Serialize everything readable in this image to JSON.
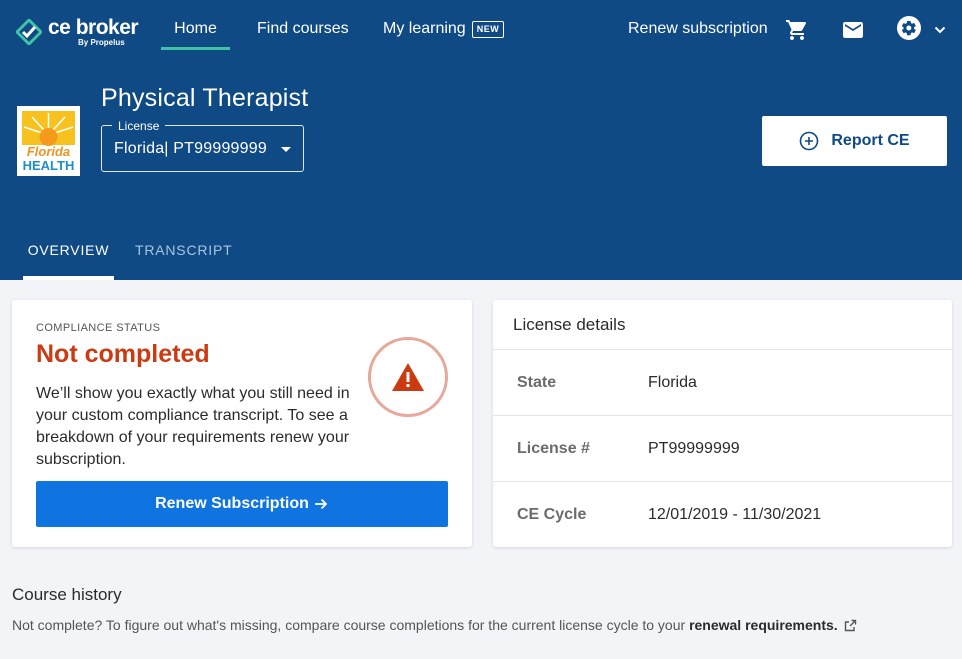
{
  "brand": {
    "name": "ce broker",
    "sub": "By Propelus"
  },
  "nav": {
    "home": "Home",
    "find_courses": "Find courses",
    "my_learning": "My learning",
    "new_badge": "NEW",
    "renew_subscription": "Renew subscription",
    "icons": [
      "cart-icon",
      "mail-icon",
      "gear-icon",
      "chevron-down-icon"
    ]
  },
  "profile": {
    "title": "Physical Therapist",
    "state_logo_text": [
      "Florida",
      "HEALTH"
    ],
    "license_label": "License",
    "license_value": "Florida| PT99999999"
  },
  "report_button": "Report CE",
  "tabs": {
    "overview": "OVERVIEW",
    "transcript": "TRANSCRIPT"
  },
  "compliance": {
    "label": "COMPLIANCE STATUS",
    "status": "Not completed",
    "text": "We’ll show you exactly what you still need in your custom compliance transcript. To see a breakdown of your requirements renew your subscription.",
    "button": "Renew Subscription"
  },
  "license_details": {
    "title": "License details",
    "rows": [
      {
        "key": "State",
        "value": "Florida"
      },
      {
        "key": "License #",
        "value": "PT99999999"
      },
      {
        "key": "CE Cycle",
        "value": "12/01/2019 - 11/30/2021"
      }
    ]
  },
  "course_history": {
    "title": "Course history",
    "text": "Not complete? To figure out what's missing, compare course completions for the current license cycle to your ",
    "link": "renewal requirements."
  },
  "colors": {
    "header_bg": "#0f4a84",
    "accent_teal": "#3fc2a6",
    "status_red": "#cc3a12",
    "primary_blue": "#0f74e0"
  }
}
